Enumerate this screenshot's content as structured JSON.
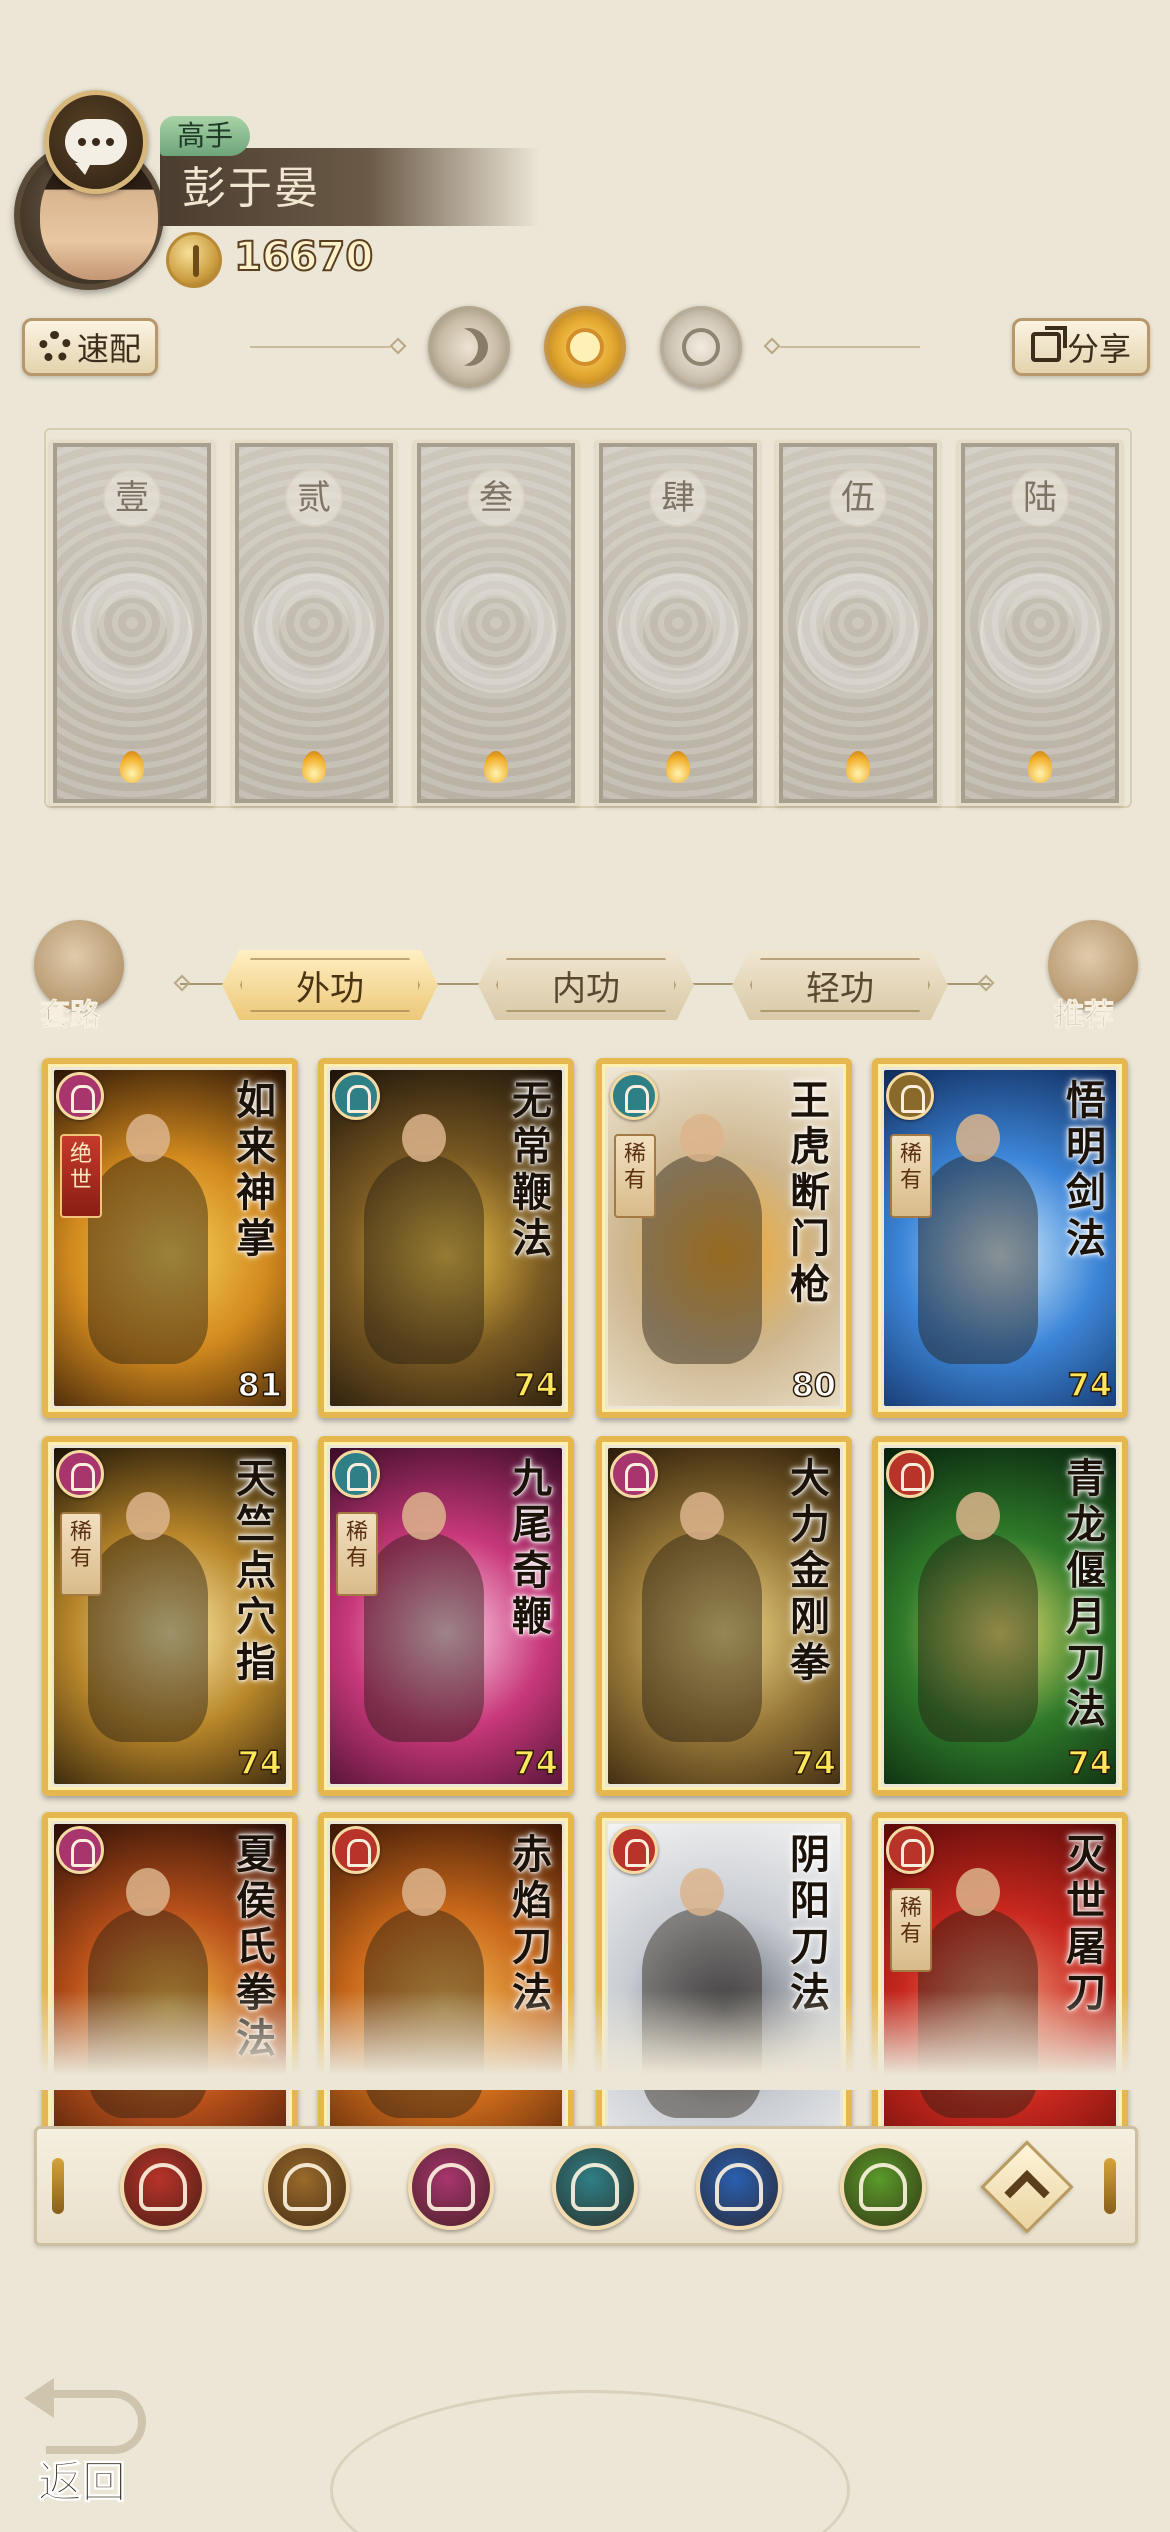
{
  "player": {
    "rank": "高手",
    "name": "彭于晏",
    "power": "16670"
  },
  "toolbar": {
    "speed_label": "速配",
    "share_label": "分享"
  },
  "slots": [
    "壹",
    "贰",
    "叁",
    "肆",
    "伍",
    "陆"
  ],
  "tabs": {
    "left_label": "套路",
    "right_label": "推荐",
    "items": [
      {
        "label": "外功",
        "active": true
      },
      {
        "label": "内功",
        "active": false
      },
      {
        "label": "轻功",
        "active": false
      }
    ]
  },
  "cards": [
    {
      "title": "如来神掌",
      "level": "81",
      "tag": "绝世",
      "tag_style": "red",
      "school_color": "#a8356e",
      "art": [
        "#2a1406",
        "#d28a1e",
        "#f9d35a"
      ]
    },
    {
      "title": "无常鞭法",
      "level": "74",
      "tag": "",
      "tag_style": "",
      "school_color": "#2f7f86",
      "art": [
        "#1b120a",
        "#7a5a22",
        "#f0c64a"
      ]
    },
    {
      "title": "王虎断门枪",
      "level": "80",
      "tag": "稀有",
      "tag_style": "",
      "school_color": "#2f7f86",
      "art": [
        "#efe6d4",
        "#cdb68e",
        "#f1a82b"
      ]
    },
    {
      "title": "悟明剑法",
      "level": "74",
      "tag": "稀有",
      "tag_style": "",
      "school_color": "#8a6a2a",
      "art": [
        "#0f2a5a",
        "#3d86d8",
        "#d8f0ff"
      ]
    },
    {
      "title": "天竺点穴指",
      "level": "74",
      "tag": "稀有",
      "tag_style": "",
      "school_color": "#a8356e",
      "art": [
        "#1a1206",
        "#b8862a",
        "#fff1b0"
      ]
    },
    {
      "title": "九尾奇鞭",
      "level": "74",
      "tag": "稀有",
      "tag_style": "",
      "school_color": "#2f7f86",
      "art": [
        "#3a0c28",
        "#c8387a",
        "#ffd6ea"
      ]
    },
    {
      "title": "大力金刚拳",
      "level": "74",
      "tag": "",
      "tag_style": "",
      "school_color": "#a8356e",
      "art": [
        "#2a1a06",
        "#9a7a3a",
        "#f2dc8a"
      ]
    },
    {
      "title": "青龙偃月刀法",
      "level": "74",
      "tag": "",
      "tag_style": "",
      "school_color": "#b8332a",
      "art": [
        "#07200c",
        "#2f7a2a",
        "#e8e070"
      ]
    },
    {
      "title": "夏侯氏拳法",
      "level": "",
      "tag": "",
      "tag_style": "",
      "school_color": "#a8356e",
      "art": [
        "#2a0e06",
        "#b8501a",
        "#f6c24a"
      ]
    },
    {
      "title": "赤焰刀法",
      "level": "",
      "tag": "",
      "tag_style": "",
      "school_color": "#b8332a",
      "art": [
        "#3a1606",
        "#c8681a",
        "#f7c05a"
      ]
    },
    {
      "title": "阴阳刀法",
      "level": "",
      "tag": "",
      "tag_style": "",
      "school_color": "#b8332a",
      "art": [
        "#f4f4f4",
        "#c8ccd2",
        "#5a5e68"
      ]
    },
    {
      "title": "灭世屠刀",
      "level": "",
      "tag": "稀有",
      "tag_style": "",
      "school_color": "#b8332a",
      "art": [
        "#5a0a08",
        "#c8281e",
        "#f0a080"
      ]
    }
  ],
  "school_filters": [
    {
      "name": "blade-school-icon",
      "color": "#b8332a"
    },
    {
      "name": "sword-school-icon",
      "color": "#9a6a2a"
    },
    {
      "name": "fist-school-icon",
      "color": "#a8356e"
    },
    {
      "name": "fan-school-icon",
      "color": "#2f7f86"
    },
    {
      "name": "taiji-school-icon",
      "color": "#2a5fb0"
    },
    {
      "name": "palm-school-icon",
      "color": "#5a9a2a"
    }
  ],
  "back_label": "返回"
}
